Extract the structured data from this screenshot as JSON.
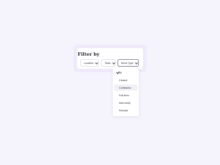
{
  "panel": {
    "title": "Filter by"
  },
  "filters": [
    {
      "label": "Location",
      "active": false
    },
    {
      "label": "Team",
      "active": false
    },
    {
      "label": "Work Type",
      "active": true
    }
  ],
  "dropdown": {
    "items": [
      {
        "label": "All",
        "selected": true
      },
      {
        "label": "Closed",
        "selected": false
      },
      {
        "label": "Contractor",
        "selected": false
      },
      {
        "label": "Full-time",
        "selected": false
      },
      {
        "label": "Internship",
        "selected": false
      },
      {
        "label": "Remote",
        "selected": false
      }
    ],
    "highlighted": "Contractor"
  },
  "colors": {
    "background": "#f5f3fb",
    "card_border": "#eeeaf9",
    "text": "#2b2b35",
    "hover": "#f1f0f6"
  }
}
